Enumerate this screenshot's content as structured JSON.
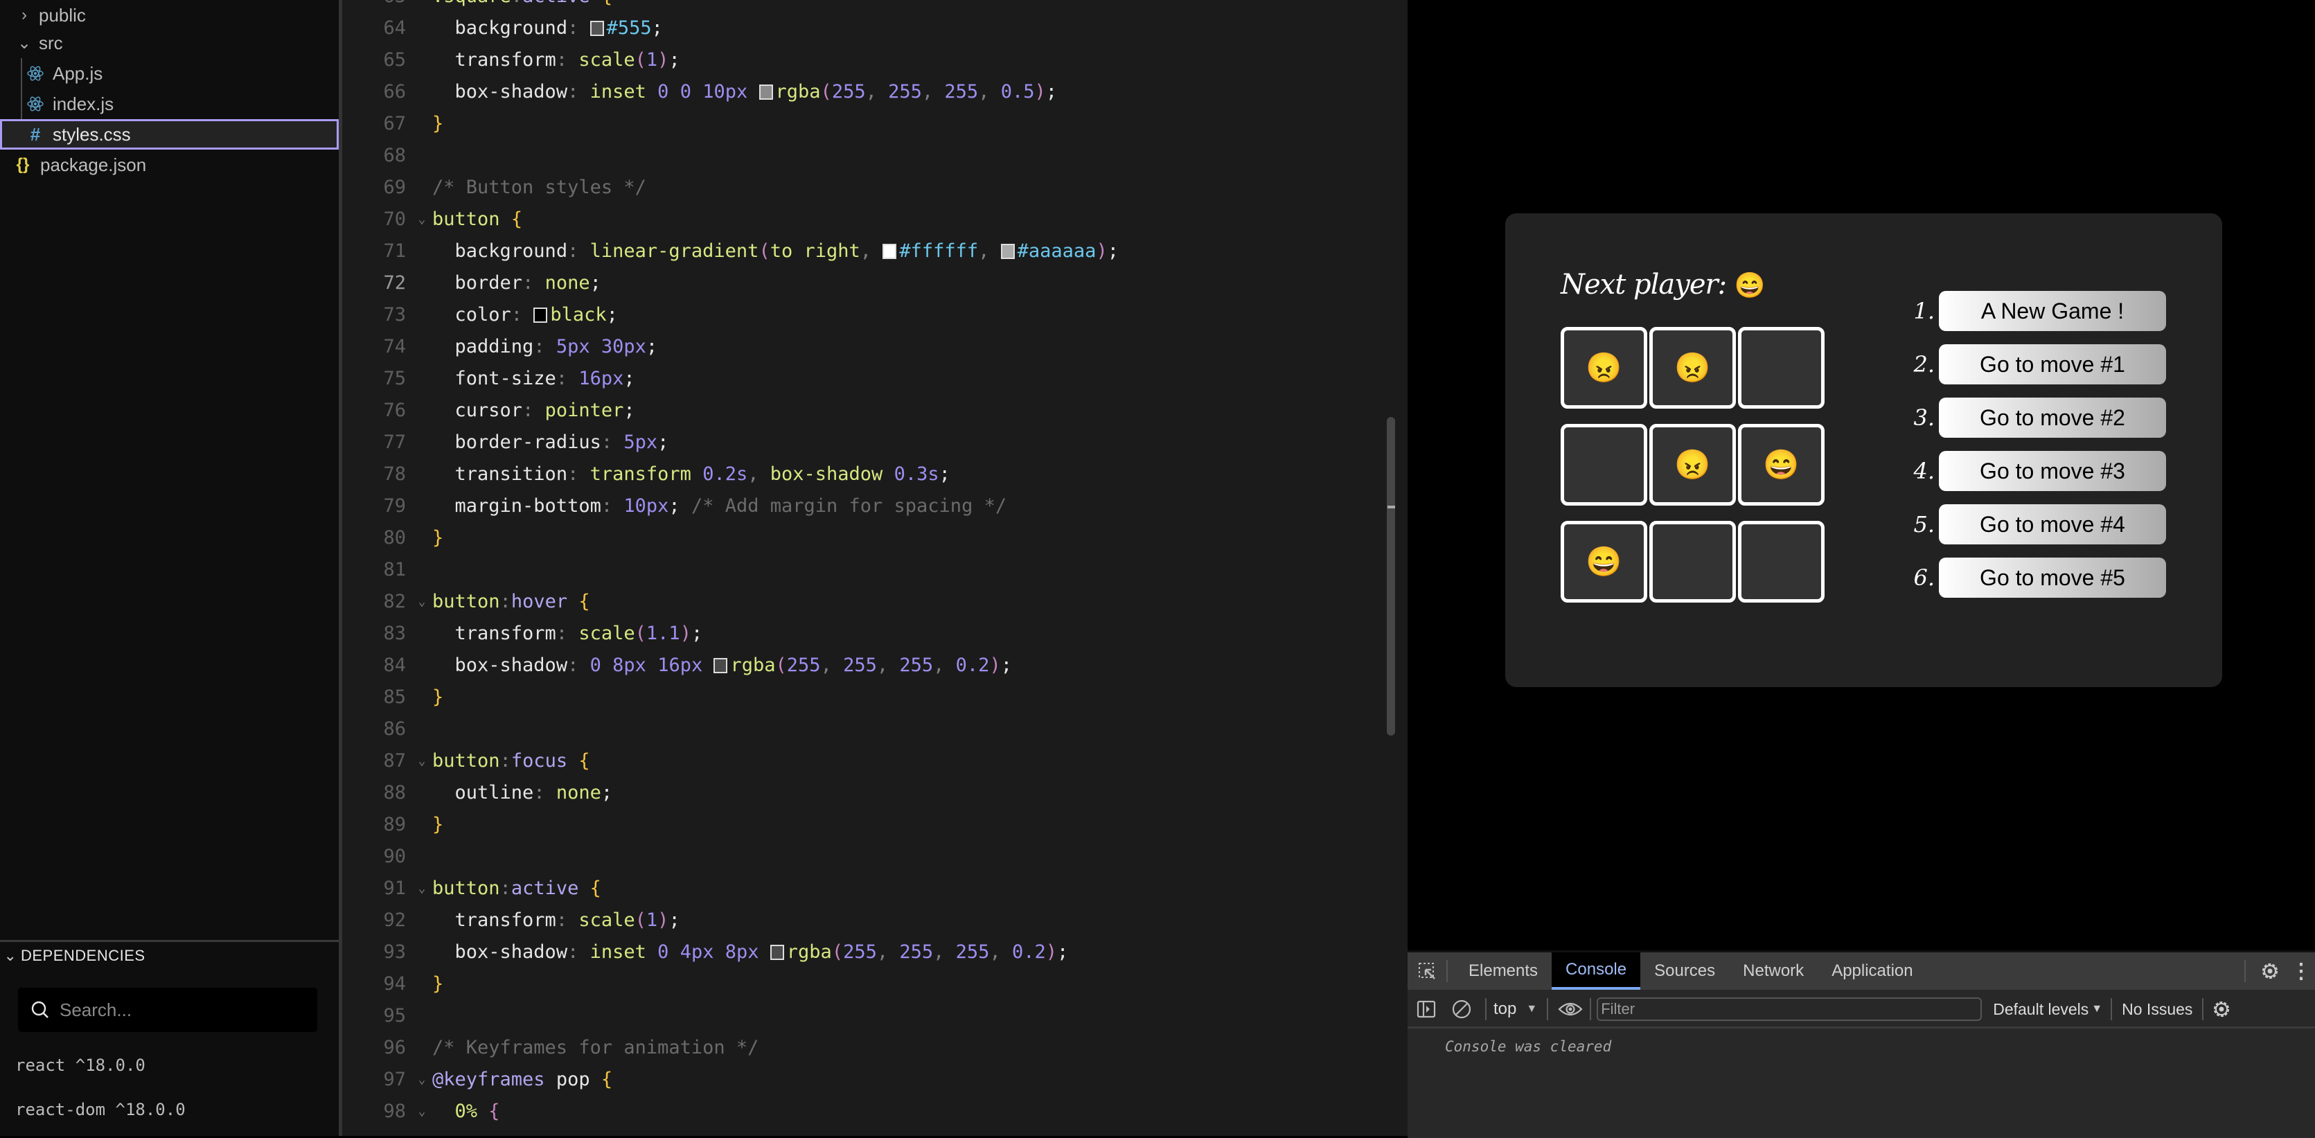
{
  "sidebar": {
    "tree": [
      {
        "label": "public",
        "type": "folder",
        "expanded": false
      },
      {
        "label": "src",
        "type": "folder",
        "expanded": true
      },
      {
        "label": "App.js",
        "type": "react-file"
      },
      {
        "label": "index.js",
        "type": "react-file"
      },
      {
        "label": "styles.css",
        "type": "css-file",
        "selected": true
      },
      {
        "label": "package.json",
        "type": "json-file"
      }
    ],
    "dependencies": {
      "title": "DEPENDENCIES",
      "search_placeholder": "Search...",
      "items": [
        "react ^18.0.0",
        "react-dom ^18.0.0"
      ]
    }
  },
  "editor": {
    "active_line": 72,
    "partial_top_line": ".square:active {",
    "lines": [
      {
        "n": 64,
        "text": "  background: #555;"
      },
      {
        "n": 65,
        "text": "  transform: scale(1);"
      },
      {
        "n": 66,
        "text": "  box-shadow: inset 0 0 10px rgba(255, 255, 255, 0.5);"
      },
      {
        "n": 67,
        "text": "}"
      },
      {
        "n": 68,
        "text": ""
      },
      {
        "n": 69,
        "text": "/* Button styles */"
      },
      {
        "n": 70,
        "text": "button {"
      },
      {
        "n": 71,
        "text": "  background: linear-gradient(to right, #ffffff, #aaaaaa);"
      },
      {
        "n": 72,
        "text": "  border: none;"
      },
      {
        "n": 73,
        "text": "  color: black;"
      },
      {
        "n": 74,
        "text": "  padding: 5px 30px;"
      },
      {
        "n": 75,
        "text": "  font-size: 16px;"
      },
      {
        "n": 76,
        "text": "  cursor: pointer;"
      },
      {
        "n": 77,
        "text": "  border-radius: 5px;"
      },
      {
        "n": 78,
        "text": "  transition: transform 0.2s, box-shadow 0.3s;"
      },
      {
        "n": 79,
        "text": "  margin-bottom: 10px; /* Add margin for spacing */"
      },
      {
        "n": 80,
        "text": "}"
      },
      {
        "n": 81,
        "text": ""
      },
      {
        "n": 82,
        "text": "button:hover {"
      },
      {
        "n": 83,
        "text": "  transform: scale(1.1);"
      },
      {
        "n": 84,
        "text": "  box-shadow: 0 8px 16px rgba(255, 255, 255, 0.2);"
      },
      {
        "n": 85,
        "text": "}"
      },
      {
        "n": 86,
        "text": ""
      },
      {
        "n": 87,
        "text": "button:focus {"
      },
      {
        "n": 88,
        "text": "  outline: none;"
      },
      {
        "n": 89,
        "text": "}"
      },
      {
        "n": 90,
        "text": ""
      },
      {
        "n": 91,
        "text": "button:active {"
      },
      {
        "n": 92,
        "text": "  transform: scale(1);"
      },
      {
        "n": 93,
        "text": "  box-shadow: inset 0 4px 8px rgba(255, 255, 255, 0.2);"
      },
      {
        "n": 94,
        "text": "}"
      },
      {
        "n": 95,
        "text": ""
      },
      {
        "n": 96,
        "text": "/* Keyframes for animation */"
      },
      {
        "n": 97,
        "text": "@keyframes pop {"
      },
      {
        "n": 98,
        "text": "  0% {"
      }
    ]
  },
  "game": {
    "status_label": "Next player: ",
    "next_player": "😄",
    "board": [
      "😠",
      "😠",
      "",
      "",
      "😠",
      "😄",
      "😄",
      "",
      ""
    ],
    "moves": [
      {
        "num": "1.",
        "label": "A New Game !"
      },
      {
        "num": "2.",
        "label": "Go to move #1"
      },
      {
        "num": "3.",
        "label": "Go to move #2"
      },
      {
        "num": "4.",
        "label": "Go to move #3"
      },
      {
        "num": "5.",
        "label": "Go to move #4"
      },
      {
        "num": "6.",
        "label": "Go to move #5"
      }
    ]
  },
  "devtools": {
    "tabs": [
      "Elements",
      "Console",
      "Sources",
      "Network",
      "Application"
    ],
    "active_tab": "Console",
    "context": "top",
    "filter_placeholder": "Filter",
    "levels": "Default levels",
    "issues": "No Issues",
    "console_message": "Console was cleared"
  },
  "colors": {
    "accent": "#a89cf5",
    "devtools_active_tab": "#7aa7f0",
    "game_panel": "#222222",
    "cell_bg": "#333333"
  }
}
